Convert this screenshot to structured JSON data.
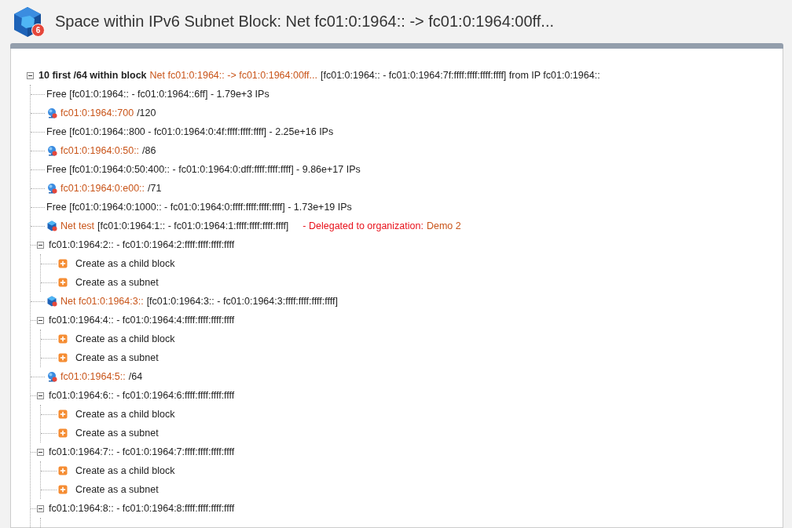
{
  "header": {
    "title": "Space within IPv6 Subnet Block: Net fc01:0:1964:: -> fc01:0:1964:00ff...",
    "badge": "6"
  },
  "tree": {
    "expanded": true,
    "label": "10 first /64 within block",
    "link": "Net fc01:0:1964:: -> fc01:0:1964:00ff...",
    "text": "[fc01:0:1964:: - fc01:0:1964:7f:ffff:ffff:ffff:ffff] from IP fc01:0:1964::",
    "children": [
      {
        "kind": "free",
        "text": "Free [fc01:0:1964:: - fc01:0:1964::6ff] - 1.79e+3 IPs"
      },
      {
        "kind": "subnet",
        "link": "fc01:0:1964::700",
        "text": "/120"
      },
      {
        "kind": "free",
        "text": "Free [fc01:0:1964::800 - fc01:0:1964:0:4f:ffff:ffff:ffff] - 2.25e+16 IPs"
      },
      {
        "kind": "subnet",
        "link": "fc01:0:1964:0:50::",
        "text": "/86"
      },
      {
        "kind": "free",
        "text": "Free [fc01:0:1964:0:50:400:: - fc01:0:1964:0:dff:ffff:ffff:ffff] - 9.86e+17 IPs"
      },
      {
        "kind": "subnet",
        "link": "fc01:0:1964:0:e00::",
        "text": "/71"
      },
      {
        "kind": "free",
        "text": "Free [fc01:0:1964:0:1000:: - fc01:0:1964:0:ffff:ffff:ffff:ffff] - 1.73e+19 IPs"
      },
      {
        "kind": "net",
        "link": "Net test",
        "text": "[fc01:0:1964:1:: - fc01:0:1964:1:ffff:ffff:ffff:ffff]",
        "note": "- Delegated to organization:",
        "org": "Demo 2"
      },
      {
        "kind": "range",
        "expanded": true,
        "text": "fc01:0:1964:2:: - fc01:0:1964:2:ffff:ffff:ffff:ffff",
        "children": [
          "Create as a child block",
          "Create as a subnet"
        ]
      },
      {
        "kind": "net",
        "link": "Net fc01:0:1964:3::",
        "text": "[fc01:0:1964:3:: - fc01:0:1964:3:ffff:ffff:ffff:ffff]"
      },
      {
        "kind": "range",
        "expanded": true,
        "text": "fc01:0:1964:4:: - fc01:0:1964:4:ffff:ffff:ffff:ffff",
        "children": [
          "Create as a child block",
          "Create as a subnet"
        ]
      },
      {
        "kind": "subnet",
        "link": "fc01:0:1964:5::",
        "text": "/64"
      },
      {
        "kind": "range",
        "expanded": true,
        "text": "fc01:0:1964:6:: - fc01:0:1964:6:ffff:ffff:ffff:ffff",
        "children": [
          "Create as a child block",
          "Create as a subnet"
        ]
      },
      {
        "kind": "range",
        "expanded": true,
        "text": "fc01:0:1964:7:: - fc01:0:1964:7:ffff:ffff:ffff:ffff",
        "children": [
          "Create as a child block",
          "Create as a subnet"
        ]
      },
      {
        "kind": "range",
        "expanded": true,
        "text": "fc01:0:1964:8:: - fc01:0:1964:8:ffff:ffff:ffff:ffff"
      }
    ]
  }
}
